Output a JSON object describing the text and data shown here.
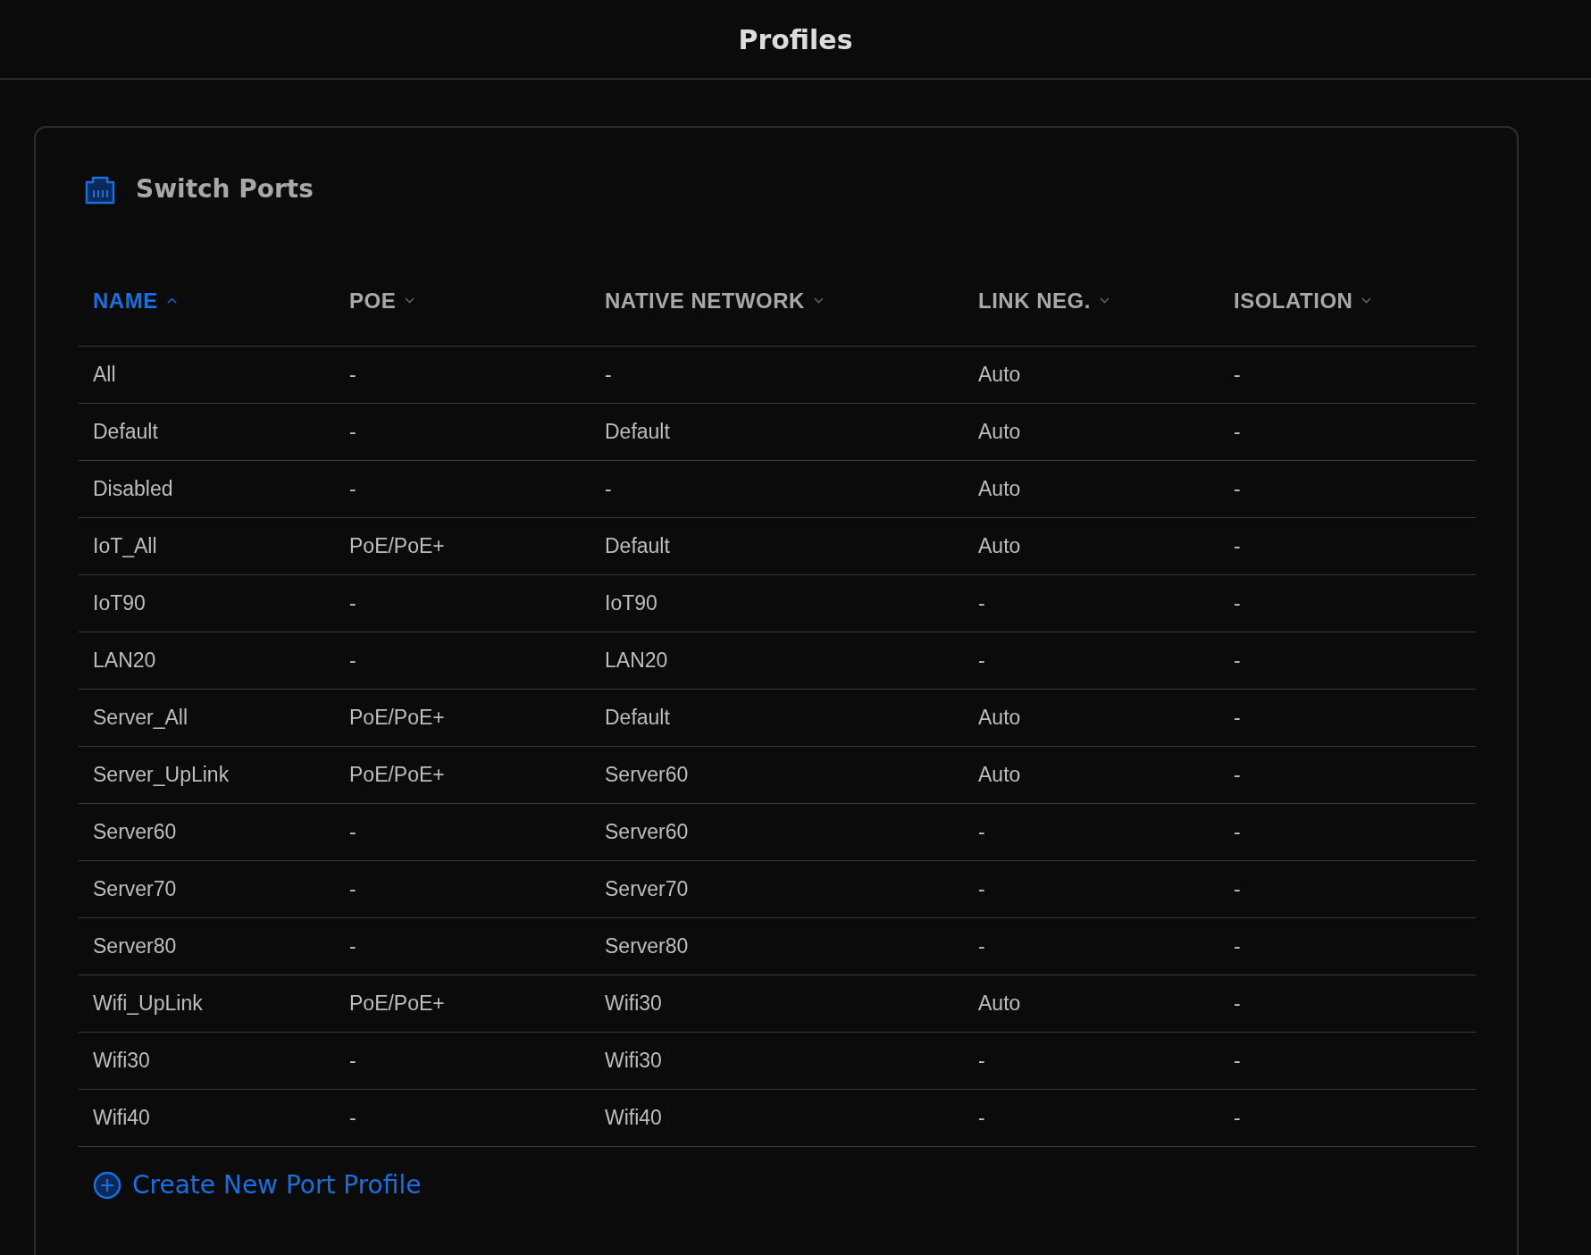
{
  "title": "Profiles",
  "section": {
    "title": "Switch Ports"
  },
  "table": {
    "columns": [
      {
        "label": "NAME",
        "selected": true
      },
      {
        "label": "POE",
        "selected": false
      },
      {
        "label": "NATIVE NETWORK",
        "selected": false
      },
      {
        "label": "LINK NEG.",
        "selected": false
      },
      {
        "label": "ISOLATION",
        "selected": false
      }
    ],
    "rows": [
      [
        "All",
        "-",
        "-",
        "Auto",
        "-"
      ],
      [
        "Default",
        "-",
        "Default",
        "Auto",
        "-"
      ],
      [
        "Disabled",
        "-",
        "-",
        "Auto",
        "-"
      ],
      [
        "IoT_All",
        "PoE/PoE+",
        "Default",
        "Auto",
        "-"
      ],
      [
        "IoT90",
        "-",
        "IoT90",
        "-",
        "-"
      ],
      [
        "LAN20",
        "-",
        "LAN20",
        "-",
        "-"
      ],
      [
        "Server_All",
        "PoE/PoE+",
        "Default",
        "Auto",
        "-"
      ],
      [
        "Server_UpLink",
        "PoE/PoE+",
        "Server60",
        "Auto",
        "-"
      ],
      [
        "Server60",
        "-",
        "Server60",
        "-",
        "-"
      ],
      [
        "Server70",
        "-",
        "Server70",
        "-",
        "-"
      ],
      [
        "Server80",
        "-",
        "Server80",
        "-",
        "-"
      ],
      [
        "Wifi_UpLink",
        "PoE/PoE+",
        "Wifi30",
        "Auto",
        "-"
      ],
      [
        "Wifi30",
        "-",
        "Wifi30",
        "-",
        "-"
      ],
      [
        "Wifi40",
        "-",
        "Wifi40",
        "-",
        "-"
      ]
    ]
  },
  "create_button": "Create New Port Profile"
}
